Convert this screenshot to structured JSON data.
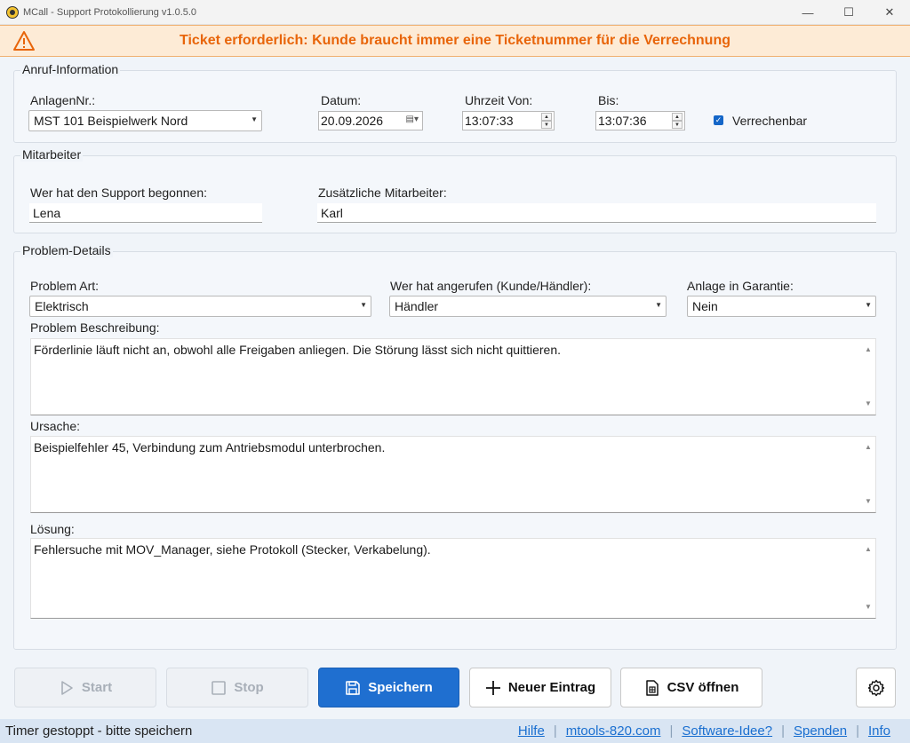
{
  "window": {
    "title": "MCall - Support Protokollierung  v1.0.5.0",
    "minimize_icon": "minimize-icon",
    "maximize_icon": "maximize-icon",
    "close_icon": "close-icon"
  },
  "banner": {
    "icon": "warning-icon",
    "text": "Ticket erforderlich: Kunde braucht immer eine Ticketnummer für die Verrechnung",
    "color": "#e8650a",
    "background": "#fdebd6"
  },
  "call_info": {
    "title": "Anruf-Information",
    "plant_label": "AnlagenNr.:",
    "plant_value": "MST 101 Beispielwerk Nord",
    "date_label": "Datum:",
    "date_value": "20.09.2026",
    "time_from_label": "Uhrzeit Von:",
    "time_from_value": "13:07:33",
    "time_to_label": "Bis:",
    "time_to_value": "13:07:36",
    "billable_label": "Verrechenbar",
    "billable_checked": true
  },
  "staff": {
    "title": "Mitarbeiter",
    "started_label": "Wer hat den Support begonnen:",
    "started_value": "Lena",
    "additional_label": "Zusätzliche Mitarbeiter:",
    "additional_value": "Karl"
  },
  "problem": {
    "title": "Problem-Details",
    "type_label": "Problem Art:",
    "type_value": "Elektrisch",
    "caller_label": "Wer hat angerufen (Kunde/Händler):",
    "caller_value": "Händler",
    "warranty_label": "Anlage in Garantie:",
    "warranty_value": "Nein",
    "description_label": "Problem Beschreibung:",
    "description_value": "Förderlinie läuft nicht an, obwohl alle Freigaben anliegen. Die Störung lässt sich nicht quittieren.",
    "cause_label": "Ursache:",
    "cause_value": "Beispielfehler 45, Verbindung zum Antriebsmodul unterbrochen.",
    "solution_label": "Lösung:",
    "solution_value": "Fehlersuche mit MOV_Manager, siehe Protokoll (Stecker, Verkabelung)."
  },
  "buttons": {
    "start": "Start",
    "stop": "Stop",
    "save": "Speichern",
    "new_entry": "Neuer Eintrag",
    "open_csv": "CSV öffnen",
    "settings_icon": "gear-icon",
    "primary_color": "#1f6fd0"
  },
  "status": {
    "text": "Timer gestoppt - bitte speichern",
    "links": [
      "Hilfe",
      "mtools-820.com",
      "Software-Idee?",
      "Spenden",
      "Info"
    ],
    "separator": "|"
  }
}
